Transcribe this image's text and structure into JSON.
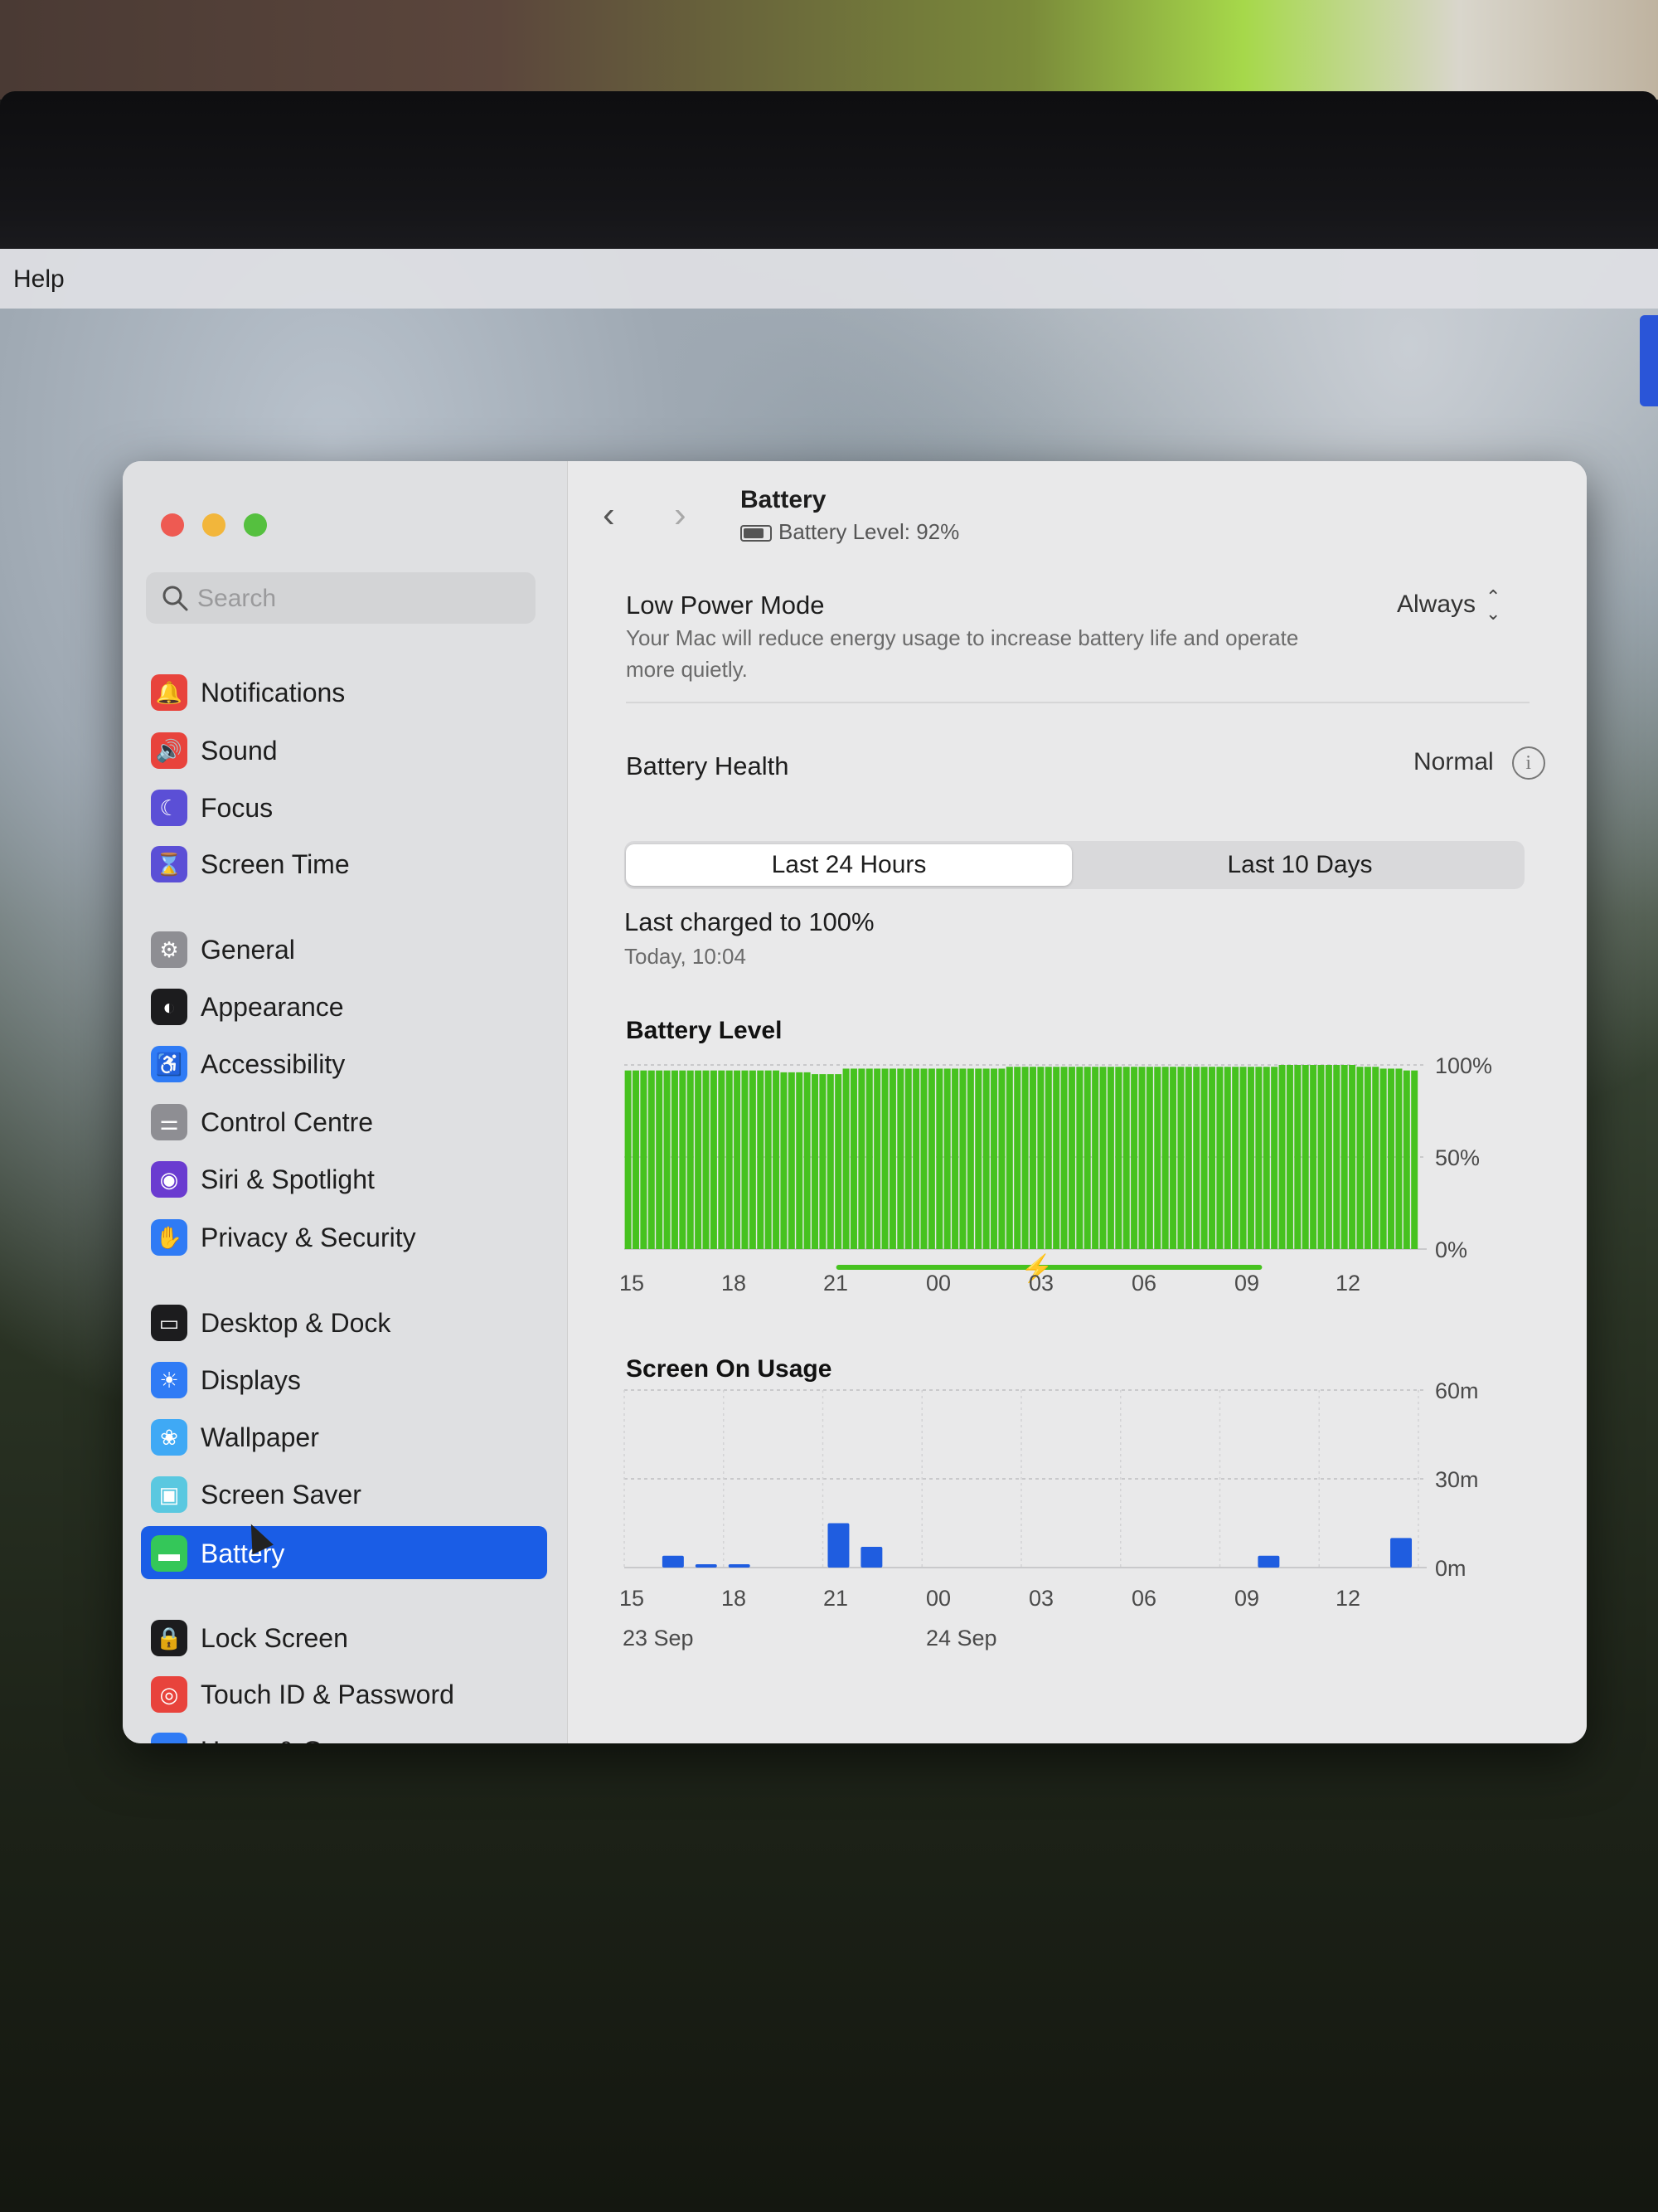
{
  "menubar": {
    "help_label": "Help"
  },
  "window": {
    "title": "Battery",
    "battery_level_text": "Battery Level: 92%"
  },
  "sidebar": {
    "search_placeholder": "Search",
    "items": [
      {
        "label": "Notifications",
        "icon": "bell-icon",
        "color": "#e8433c"
      },
      {
        "label": "Sound",
        "icon": "speaker-icon",
        "color": "#e8433c"
      },
      {
        "label": "Focus",
        "icon": "moon-icon",
        "color": "#5b4fd6"
      },
      {
        "label": "Screen Time",
        "icon": "hourglass-icon",
        "color": "#5b4fd6"
      },
      {
        "label": "General",
        "icon": "gear-icon",
        "color": "#8e8e93"
      },
      {
        "label": "Appearance",
        "icon": "appearance-icon",
        "color": "#1c1c1e"
      },
      {
        "label": "Accessibility",
        "icon": "accessibility-icon",
        "color": "#2f7bf5"
      },
      {
        "label": "Control Centre",
        "icon": "toggles-icon",
        "color": "#8e8e93"
      },
      {
        "label": "Siri & Spotlight",
        "icon": "siri-icon",
        "color": "#6a3bd0"
      },
      {
        "label": "Privacy & Security",
        "icon": "hand-icon",
        "color": "#2f7bf5"
      },
      {
        "label": "Desktop & Dock",
        "icon": "dock-icon",
        "color": "#1c1c1e"
      },
      {
        "label": "Displays",
        "icon": "sun-icon",
        "color": "#2f7bf5"
      },
      {
        "label": "Wallpaper",
        "icon": "flower-icon",
        "color": "#3fa9f5"
      },
      {
        "label": "Screen Saver",
        "icon": "screen-saver-icon",
        "color": "#5ac8e0"
      },
      {
        "label": "Battery",
        "icon": "battery-icon",
        "color": "#34c759",
        "selected": true
      },
      {
        "label": "Lock Screen",
        "icon": "lock-icon",
        "color": "#1c1c1e"
      },
      {
        "label": "Touch ID & Password",
        "icon": "fingerprint-icon",
        "color": "#e8433c"
      },
      {
        "label": "Users & Groups",
        "icon": "users-icon",
        "color": "#2f7bf5"
      }
    ]
  },
  "low_power": {
    "title": "Low Power Mode",
    "description": "Your Mac will reduce energy usage to increase battery life and operate more quietly.",
    "value": "Always"
  },
  "battery_health": {
    "title": "Battery Health",
    "value": "Normal"
  },
  "segmented": {
    "option_1": "Last 24 Hours",
    "option_2": "Last 10 Days",
    "selected": "Last 24 Hours"
  },
  "last_charged": {
    "title": "Last charged to 100%",
    "time": "Today, 10:04"
  },
  "chart_data": [
    {
      "type": "bar",
      "title": "Battery Level",
      "x_ticks": [
        "15",
        "18",
        "21",
        "00",
        "03",
        "06",
        "09",
        "12"
      ],
      "y_ticks": [
        "100%",
        "50%",
        "0%"
      ],
      "ylim": [
        0,
        100
      ],
      "values": [
        97,
        97,
        97,
        97,
        97,
        97,
        97,
        97,
        97,
        97,
        97,
        97,
        97,
        97,
        97,
        97,
        97,
        97,
        97,
        97,
        96,
        96,
        96,
        96,
        95,
        95,
        95,
        95,
        98,
        98,
        98,
        98,
        98,
        98,
        98,
        98,
        98,
        98,
        98,
        98,
        98,
        98,
        98,
        98,
        98,
        98,
        98,
        98,
        98,
        99,
        99,
        99,
        99,
        99,
        99,
        99,
        99,
        99,
        99,
        99,
        99,
        99,
        99,
        99,
        99,
        99,
        99,
        99,
        99,
        99,
        99,
        99,
        99,
        99,
        99,
        99,
        99,
        99,
        99,
        99,
        99,
        99,
        99,
        99,
        100,
        100,
        100,
        100,
        100,
        100,
        100,
        100,
        100,
        100,
        99,
        99,
        99,
        98,
        98,
        98,
        97,
        97
      ],
      "charging_indicator": true,
      "color": "#46c21f"
    },
    {
      "type": "bar",
      "title": "Screen On Usage",
      "x_ticks": [
        "15",
        "18",
        "21",
        "00",
        "03",
        "06",
        "09",
        "12"
      ],
      "date_labels": [
        "23 Sep",
        "24 Sep"
      ],
      "y_ticks": [
        "60m",
        "30m",
        "0m"
      ],
      "ylim": [
        0,
        60
      ],
      "bars": [
        {
          "hour_offset": 1,
          "value": 4
        },
        {
          "hour_offset": 2,
          "value": 1
        },
        {
          "hour_offset": 3,
          "value": 1
        },
        {
          "hour_offset": 6,
          "value": 15
        },
        {
          "hour_offset": 7,
          "value": 7
        },
        {
          "hour_offset": 19,
          "value": 4
        },
        {
          "hour_offset": 23,
          "value": 10
        }
      ],
      "color": "#1f5de0"
    }
  ]
}
